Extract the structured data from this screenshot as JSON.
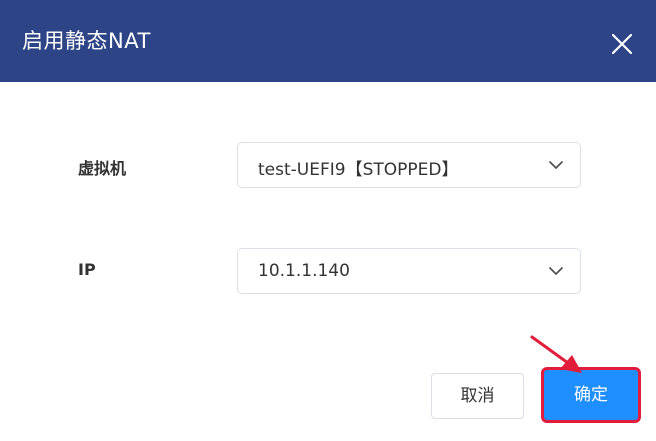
{
  "dialog": {
    "title": "启用静态NAT",
    "close_icon": "close-icon"
  },
  "form": {
    "vm": {
      "label": "虚拟机",
      "value": "test-UEFI9【STOPPED】"
    },
    "ip": {
      "label": "IP",
      "value": "10.1.1.140"
    }
  },
  "buttons": {
    "cancel_label": "取消",
    "confirm_label": "确定"
  },
  "colors": {
    "header": "#2d4586",
    "primary": "#1f8fff",
    "highlight": "#e11d3b"
  }
}
